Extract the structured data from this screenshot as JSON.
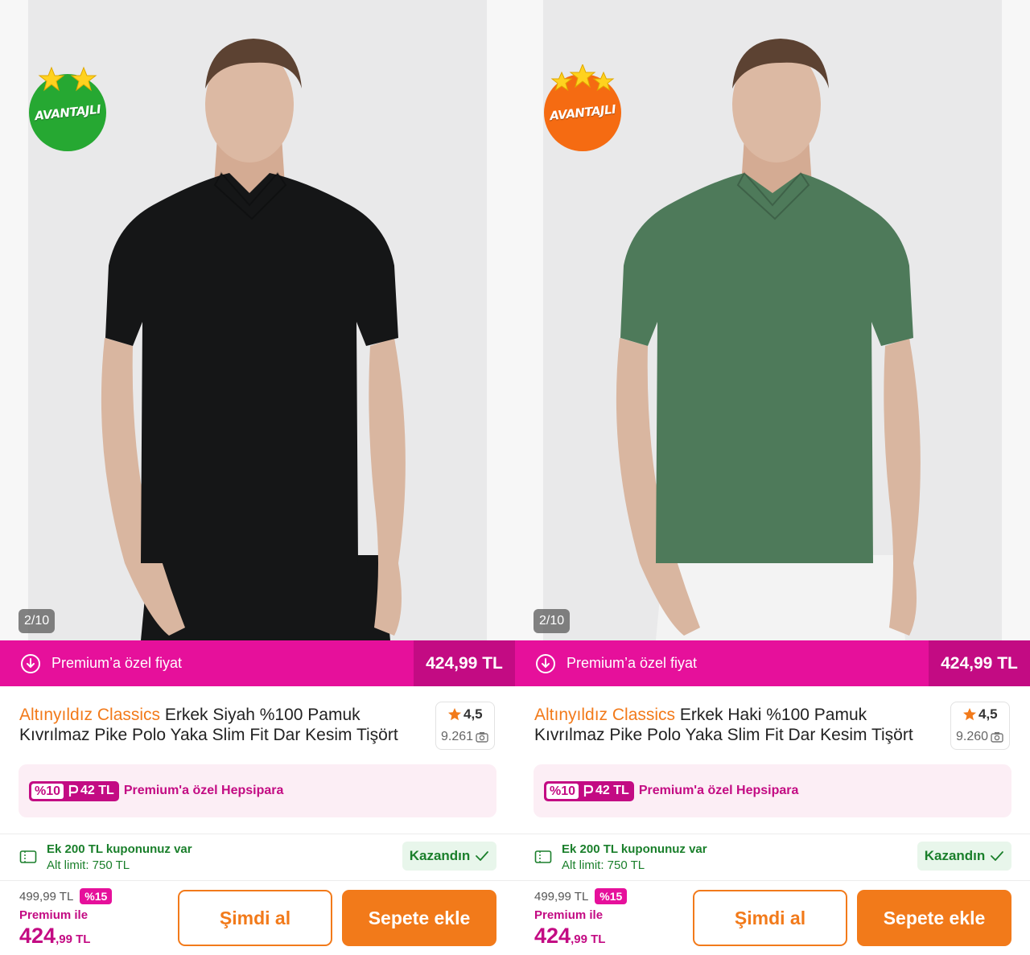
{
  "products": [
    {
      "badge_label": "AVANTAJLI",
      "badge_color": "#26a832",
      "badge_stars": 2,
      "image_counter": "2/10",
      "shirt_color": "#151617",
      "pants_color": "#151617",
      "premium_label": "Premium’a özel fiyat",
      "premium_price": "424,99 TL",
      "brand": "Altınyıldız Classics",
      "title": " Erkek Siyah %100 Pamuk Kıvrılmaz Pike Polo Yaka Slim Fit Dar Kesim Tişört",
      "rating": "4,5",
      "review_count": "9.261",
      "hepsipara": {
        "percent": "%10",
        "amount": "42 TL",
        "label": "Premium'a özel Hepsipara"
      },
      "coupon": {
        "title": "Ek 200 TL kuponunuz var",
        "limit": "Alt limit: 750 TL",
        "status": "Kazandın"
      },
      "old_price": "499,99 TL",
      "discount": "%15",
      "premium_with": "Premium ile",
      "price_main": "424",
      "price_decimal": ",99 TL",
      "buy_now_label": "Şimdi al",
      "add_to_cart_label": "Sepete ekle"
    },
    {
      "badge_label": "AVANTAJLI",
      "badge_color": "#f56b12",
      "badge_stars": 3,
      "image_counter": "2/10",
      "shirt_color": "#4e7a5a",
      "pants_color": "#f3f3f3",
      "premium_label": "Premium’a özel fiyat",
      "premium_price": "424,99 TL",
      "brand": "Altınyıldız Classics",
      "title": " Erkek Haki %100 Pamuk Kıvrılmaz Pike Polo Yaka Slim Fit Dar Kesim Tişört",
      "rating": "4,5",
      "review_count": "9.260",
      "hepsipara": {
        "percent": "%10",
        "amount": "42 TL",
        "label": "Premium'a özel Hepsipara"
      },
      "coupon": {
        "title": "Ek 200 TL kuponunuz var",
        "limit": "Alt limit: 750 TL",
        "status": "Kazandın"
      },
      "old_price": "499,99 TL",
      "discount": "%15",
      "premium_with": "Premium ile",
      "price_main": "424",
      "price_decimal": ",99 TL",
      "buy_now_label": "Şimdi al",
      "add_to_cart_label": "Sepete ekle"
    }
  ]
}
